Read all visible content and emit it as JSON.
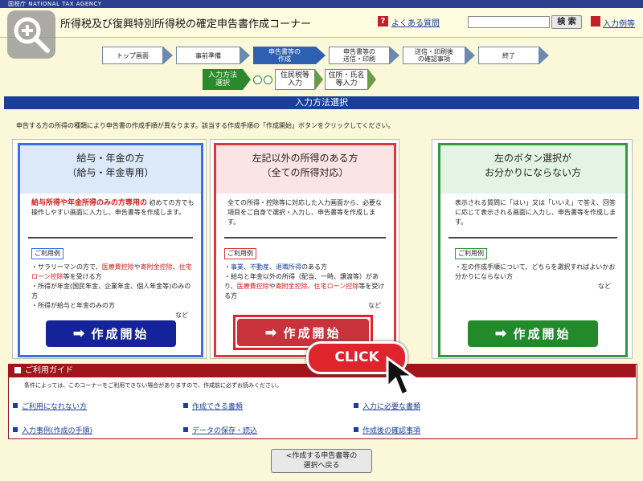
{
  "header": {
    "agency": "国税庁  NATIONAL TAX AGENCY",
    "title": "所得税及び復興特別所得税の確定申告書作成コーナー",
    "faq": "よくある質問",
    "search_button": "検 索",
    "guide": "入力例等"
  },
  "steps": {
    "s1": "トップ画面",
    "s2": "事前準備",
    "s3a": "申告書等の",
    "s3b": "作成",
    "s4a": "申告書等の",
    "s4b": "送信・印刷",
    "s5a": "送信・印刷後",
    "s5b": "の確認事項",
    "s6": "終了"
  },
  "substeps": {
    "a1": "入力方法",
    "a2": "選択",
    "b1": "住民税等",
    "b2": "入力",
    "c1": "住所・氏名",
    "c2": "等入力"
  },
  "section_title": "入力方法選択",
  "instruction": "申告する方の所得の種類により申告書の作成手順が異なります。該当する作成手順の「作成開始」ボタンをクリックしてください。",
  "panels": {
    "blue": {
      "title1": "給与・年金の方",
      "title2": "（給与・年金専用）",
      "lead": "給与所得や年金所得のみの方専用の",
      "desc": "初めての方でも操作しやすい画面に入力し、申告書等を作成します。",
      "tag": "ご利用例",
      "l1a": "・サラリーマンの方で、",
      "l1b": "医療費控除",
      "l1c": "や",
      "l1d": "寄附金控除",
      "l1e": "、",
      "l1f": "住宅ローン控除",
      "l1g": "等を受ける方",
      "l2": "・所得が年金(国民年金、企業年金、個人年金等)のみの方",
      "l3": "・所得が給与と年金のみの方",
      "etc": "など",
      "button": "作成開始"
    },
    "red": {
      "title1": "左記以外の所得のある方",
      "title2": "（全ての所得対応）",
      "desc": "全ての所得・控除等に対応した入力画面から、必要な項目をご自身で選択・入力し、申告書等を作成します。",
      "tag": "ご利用例",
      "l1a": "・",
      "l1b": "事業、不動産、退職所得",
      "l1c": "のある方",
      "l2a": "・給与と年金以外の所得（配当、一時、譲渡等）があり、",
      "l2b": "医療費控除",
      "l2c": "や",
      "l2d": "寄附金控除、住宅ローン控除",
      "l2e": "等を受ける方",
      "etc": "など",
      "button": "作成開始"
    },
    "green": {
      "title1": "左のボタン選択が",
      "title2": "お分かりにならない方",
      "desc": "表示される質問に「はい」又は「いいえ」で答え、回答に応じて表示される画面に入力し、申告書等を作成します。",
      "tag": "ご利用例",
      "l1": "・左の作成手順について、どちらを選択すればよいかお分かりにならない方",
      "etc": "など",
      "button": "作成開始"
    }
  },
  "click_label": "CLICK",
  "guide": {
    "header": "ご利用ガイド",
    "note": "条件によっては、このコーナーをご利用できない場合がありますので、作成前に必ずお読みください。",
    "links": [
      "ご利用になれない方",
      "作成できる書類",
      "入力に必要な書類",
      "入力事例(作成の手順)",
      "データの保存・読込",
      "作成後の確認事項"
    ]
  },
  "back": {
    "line1": "<作成する申告書等の",
    "line2": "選択へ戻る"
  },
  "colors": {
    "blue": "#3a6ee8",
    "red": "#d63a3a",
    "green": "#2e9a3a",
    "navy": "#1a3e9a"
  }
}
